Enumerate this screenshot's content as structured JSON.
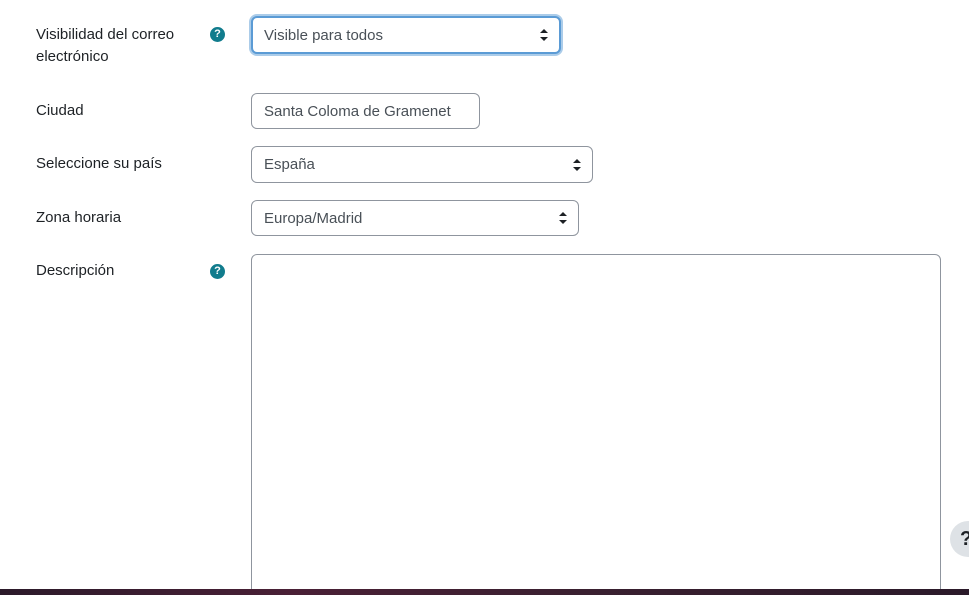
{
  "email_visibility": {
    "label": "Visibilidad del correo electrónico",
    "help": "?",
    "value": "Visible para todos"
  },
  "city": {
    "label": "Ciudad",
    "value": "Santa Coloma de Gramenet"
  },
  "country": {
    "label": "Seleccione su país",
    "value": "España"
  },
  "timezone": {
    "label": "Zona horaria",
    "value": "Europa/Madrid"
  },
  "description": {
    "label": "Descripción",
    "help": "?",
    "value": ""
  },
  "floating_help": {
    "label": "?"
  },
  "colors": {
    "help_icon": "#117c8d",
    "focus_ring": "#5b9bd5",
    "border": "#8f959e"
  }
}
